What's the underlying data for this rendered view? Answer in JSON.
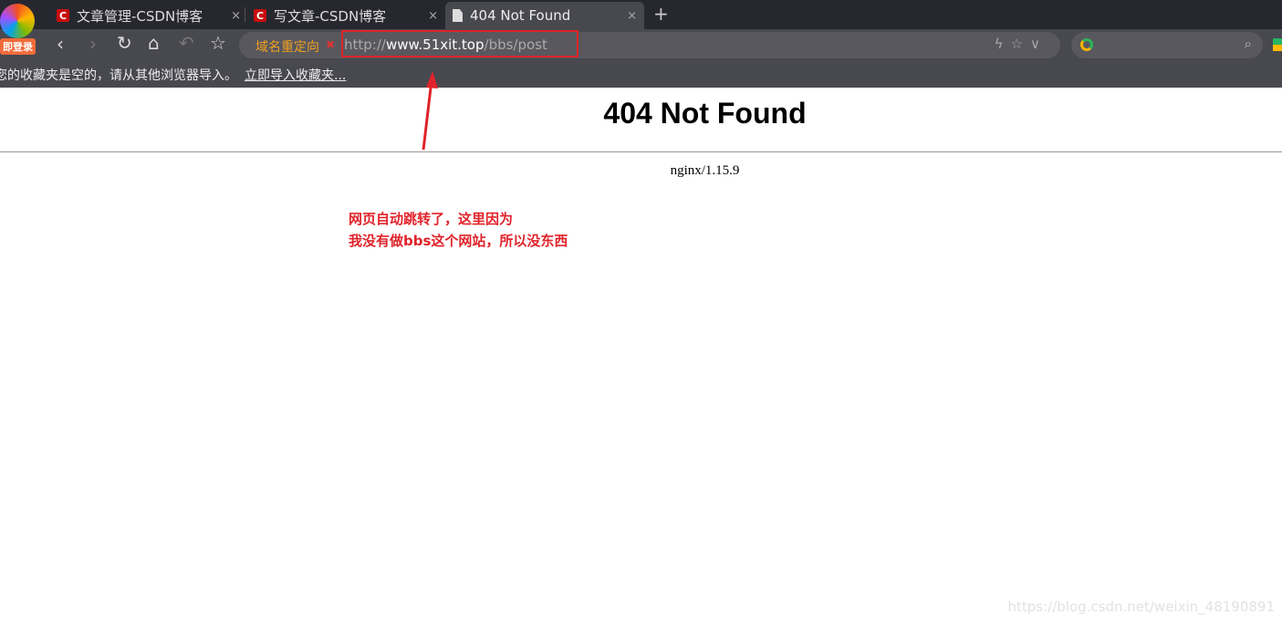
{
  "browser": {
    "login_badge": "即登录",
    "tabs": [
      {
        "title": "文章管理-CSDN博客",
        "favicon": "csdn-icon",
        "close": "×"
      },
      {
        "title": "写文章-CSDN博客",
        "favicon": "csdn-icon",
        "close": "×"
      },
      {
        "title": "404 Not Found",
        "favicon": "document-icon",
        "close": "×",
        "active": true
      }
    ],
    "new_tab": "+",
    "address": {
      "redirect_label": "域名重定向",
      "scheme": "http://",
      "host": "www.51xit.top",
      "path": "/bbs/post"
    },
    "bookmarks_bar": {
      "message": "您的收藏夹是空的，请从其他浏览器导入。",
      "import_link": "立即导入收藏夹..."
    }
  },
  "page": {
    "title": "404 Not Found",
    "server": "nginx/1.15.9"
  },
  "annotation": {
    "line1": "网页自动跳转了，这里因为",
    "line2": "我没有做bbs这个网站，所以没东西",
    "color": "#e0232a"
  },
  "watermark": "https://blog.csdn.net/weixin_48190891"
}
